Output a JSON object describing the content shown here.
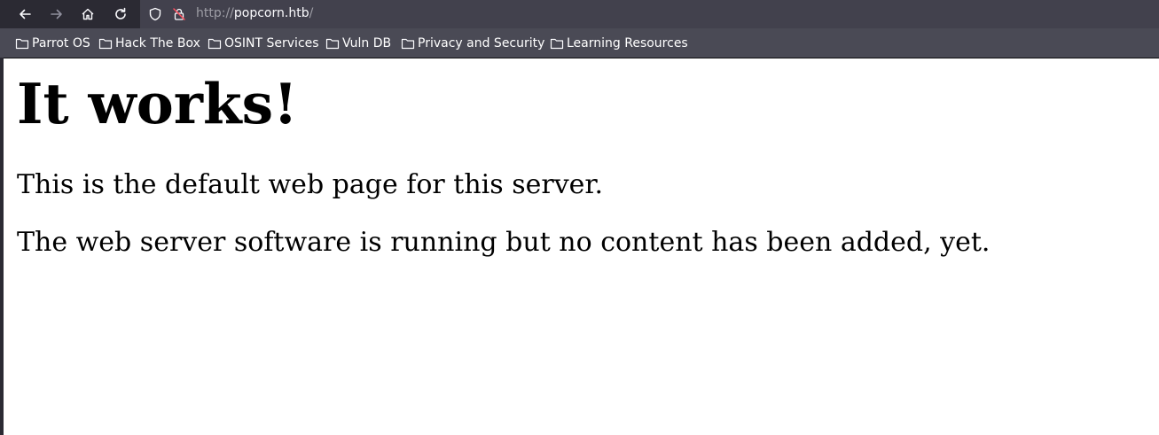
{
  "browser": {
    "url": {
      "protocol": "http://",
      "host": "popcorn.htb",
      "path": "/"
    },
    "icons": {
      "back": "arrow-left-icon",
      "forward": "arrow-right-icon",
      "home": "home-icon",
      "reload": "reload-icon",
      "tracking": "shield-icon",
      "security": "insecure-lock-icon"
    }
  },
  "bookmarks": [
    {
      "label": "Parrot OS"
    },
    {
      "label": "Hack The Box"
    },
    {
      "label": "OSINT Services"
    },
    {
      "label": "Vuln DB"
    },
    {
      "label": "Privacy and Security"
    },
    {
      "label": "Learning Resources"
    }
  ],
  "page": {
    "heading": "It works!",
    "paragraphs": [
      "This is the default web page for this server.",
      "The web server software is running but no content has been added, yet."
    ]
  },
  "colors": {
    "toolbar": "#2b2a33",
    "urlbar": "#42414d",
    "bookmarks_bar": "#4a4a55",
    "page_background": "#ffffff",
    "text": "#000000"
  }
}
